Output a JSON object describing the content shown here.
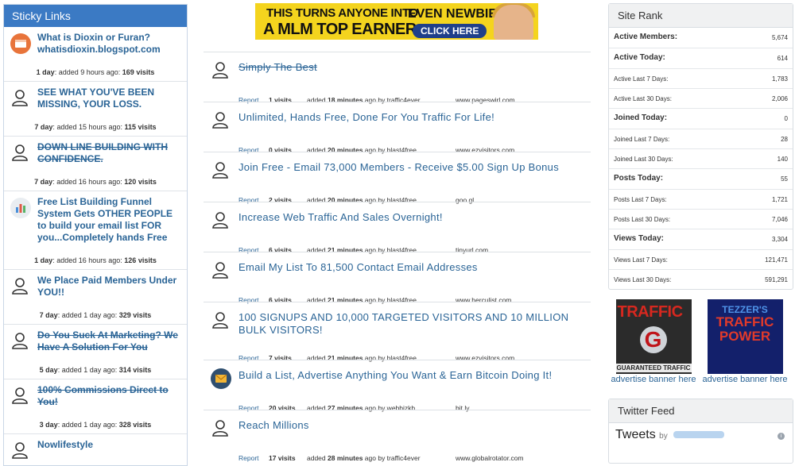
{
  "sticky": {
    "title": "Sticky Links",
    "items": [
      {
        "title": "What is Dioxin or Furan? whatisdioxin.blogspot.com",
        "strike": false,
        "icon": "browser-icon",
        "days": "1 day",
        "ago": "added 9 hours ago:",
        "visits": "169 visits"
      },
      {
        "title": "SEE WHAT YOU'VE BEEN MISSING, YOUR LOSS.",
        "strike": false,
        "icon": "user-icon",
        "days": "7 day",
        "ago": "added 15 hours ago:",
        "visits": "115 visits"
      },
      {
        "title": "DOWN LINE BUILDING WITH CONFIDENCE.",
        "strike": true,
        "icon": "user-icon",
        "days": "7 day",
        "ago": "added 16 hours ago:",
        "visits": "120 visits"
      },
      {
        "title": "Free List Building Funnel System Gets OTHER PEOPLE to build your email list FOR you...Completely hands Free",
        "strike": false,
        "icon": "chart-icon",
        "days": "1 day",
        "ago": "added 16 hours ago:",
        "visits": "126 visits"
      },
      {
        "title": "We Place Paid Members Under YOU!!",
        "strike": false,
        "icon": "user-icon",
        "days": "7 day",
        "ago": "added 1 day ago:",
        "visits": "329 visits"
      },
      {
        "title": "Do You Suck At Marketing? We Have A Solution For You",
        "strike": true,
        "icon": "user-icon",
        "days": "5 day",
        "ago": "added 1 day ago:",
        "visits": "314 visits"
      },
      {
        "title": "100% Commissions Direct to You!",
        "strike": true,
        "icon": "user-icon",
        "days": "3 day",
        "ago": "added 1 day ago:",
        "visits": "328 visits"
      },
      {
        "title": "Nowlifestyle",
        "strike": false,
        "icon": "user-icon",
        "days": "",
        "ago": "",
        "visits": ""
      }
    ]
  },
  "banner": {
    "line1": "THIS TURNS ANYONE INTO",
    "line2": "A MLM TOP EARNER",
    "line3": "EVEN NEWBIES",
    "cta": "CLICK HERE"
  },
  "feed": {
    "report_label": "Report",
    "items": [
      {
        "title": "Simply The Best",
        "strike": true,
        "bold": false,
        "icon": "user-icon",
        "visits": "1 visits",
        "added": "added",
        "time": "18 minutes",
        "by": "ago by traffic4ever",
        "domain": "www.pageswirl.com"
      },
      {
        "title": "Unlimited, Hands Free, Done For You Traffic For Life!",
        "strike": false,
        "bold": false,
        "icon": "user-icon",
        "visits": "0 visits",
        "added": "added",
        "time": "20 minutes",
        "by": "ago by blast4free",
        "domain": "www.ezvisitors.com"
      },
      {
        "title": "Join Free - Email 73,000 Members - Receive $5.00 Sign Up Bonus",
        "strike": false,
        "bold": false,
        "icon": "user-icon",
        "visits": "2 visits",
        "added": "added",
        "time": "20 minutes",
        "by": "ago by blast4free",
        "domain": "goo.gl"
      },
      {
        "title": "Increase Web Traffic And Sales Overnight!",
        "strike": false,
        "bold": false,
        "icon": "user-icon",
        "visits": "6 visits",
        "added": "added",
        "time": "21 minutes",
        "by": "ago by blast4free",
        "domain": "tinyurl.com"
      },
      {
        "title": "Email My List To 81,500 Contact Email Addresses",
        "strike": false,
        "bold": false,
        "icon": "user-icon",
        "visits": "6 visits",
        "added": "added",
        "time": "21 minutes",
        "by": "ago by blast4free",
        "domain": "www.herculist.com"
      },
      {
        "title": "100 SIGNUPS AND 10,000 TARGETED VISITORS AND 10 MILLION BULK VISITORS!",
        "strike": false,
        "bold": false,
        "icon": "user-icon",
        "visits": "7 visits",
        "added": "added",
        "time": "21 minutes",
        "by": "ago by blast4free",
        "domain": "www.ezvisitors.com"
      },
      {
        "title": "Build a List, Advertise Anything You Want & Earn Bitcoin Doing It!",
        "strike": false,
        "bold": false,
        "icon": "mail-icon",
        "visits": "20 visits",
        "added": "added",
        "time": "27 minutes",
        "by": "ago by webbizkb",
        "domain": "bit.ly"
      },
      {
        "title": "Reach Millions",
        "strike": false,
        "bold": false,
        "icon": "user-icon",
        "visits": "17 visits",
        "added": "added",
        "time": "28 minutes",
        "by": "ago by traffic4ever",
        "domain": "www.globalrotator.com"
      }
    ]
  },
  "rank": {
    "title": "Site Rank",
    "rows": [
      {
        "label": "Active Members:",
        "value": "5,674",
        "bold": true
      },
      {
        "label": "Active Today:",
        "value": "614",
        "bold": true
      },
      {
        "label": "Active Last 7 Days:",
        "value": "1,783",
        "bold": false
      },
      {
        "label": "Active Last 30 Days:",
        "value": "2,006",
        "bold": false
      },
      {
        "label": "Joined Today:",
        "value": "0",
        "bold": true
      },
      {
        "label": "Joined Last 7 Days:",
        "value": "28",
        "bold": false
      },
      {
        "label": "Joined Last 30 Days:",
        "value": "140",
        "bold": false
      },
      {
        "label": "Posts Today:",
        "value": "55",
        "bold": true
      },
      {
        "label": "Posts Last 7 Days:",
        "value": "1,721",
        "bold": false
      },
      {
        "label": "Posts Last 30 Days:",
        "value": "7,046",
        "bold": false
      },
      {
        "label": "Views Today:",
        "value": "3,304",
        "bold": true
      },
      {
        "label": "Views Last 7 Days:",
        "value": "121,471",
        "bold": false
      },
      {
        "label": "Views Last 30 Days:",
        "value": "591,291",
        "bold": false
      }
    ]
  },
  "ads": {
    "ad1": {
      "line1": "TRAFFIC",
      "logo": "G",
      "line2": "GUARANTEED TRAFFIC",
      "caption": "advertise banner here"
    },
    "ad2": {
      "line1": "TEZZER'S",
      "line2": "TRAFFIC POWER",
      "caption": "advertise banner here"
    }
  },
  "twitter": {
    "title": "Twitter Feed",
    "tweets_label": "Tweets",
    "by_label": "by",
    "info_icon": "i"
  }
}
